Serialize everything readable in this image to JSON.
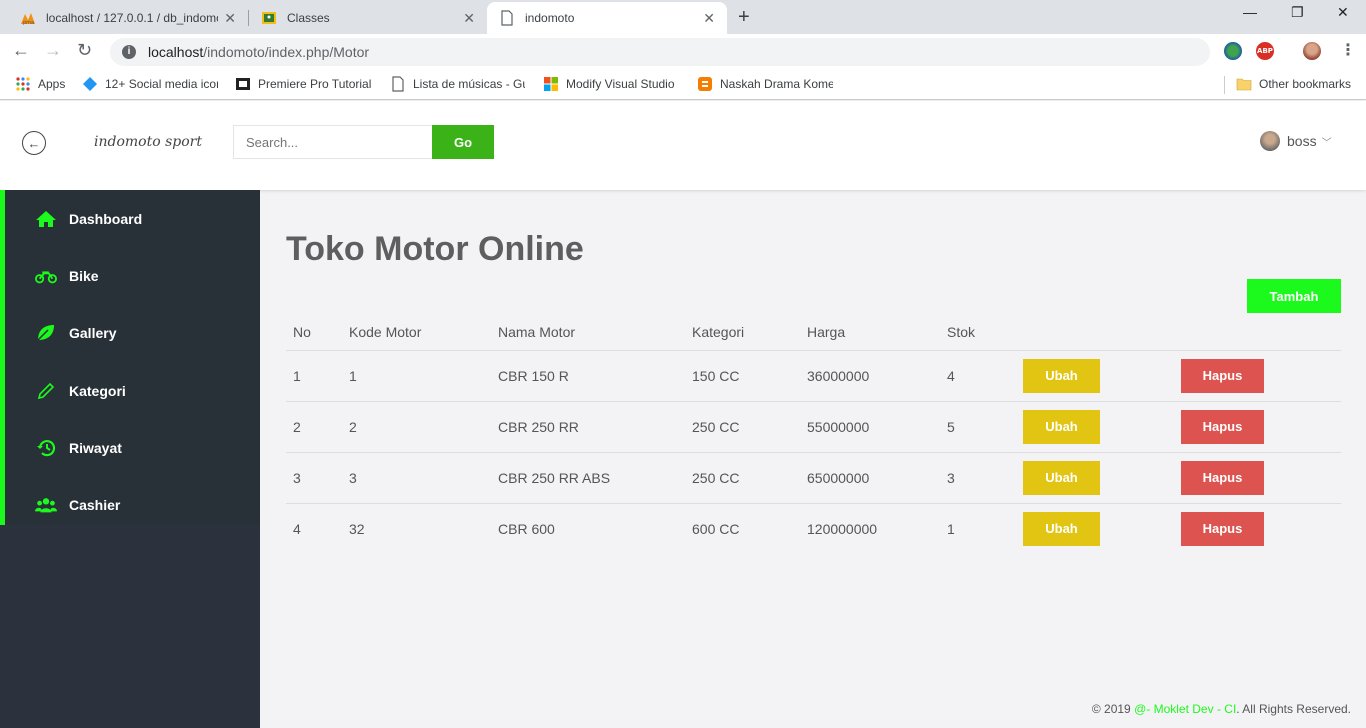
{
  "browser": {
    "tabs": [
      {
        "title": "localhost / 127.0.0.1 / db_indomoto",
        "icon": "phpmyadmin-icon"
      },
      {
        "title": "Classes",
        "icon": "classroom-icon"
      },
      {
        "title": "indomoto",
        "icon": "page-icon"
      }
    ],
    "url_host": "localhost",
    "url_path": "/indomoto/index.php/Motor",
    "bookmarks": [
      {
        "label": "Apps"
      },
      {
        "label": "12+ Social media icon"
      },
      {
        "label": "Premiere Pro Tutorial"
      },
      {
        "label": "Lista de músicas - Gu"
      },
      {
        "label": "Modify Visual Studio"
      },
      {
        "label": "Naskah Drama Kome"
      }
    ],
    "other_bookmarks": "Other bookmarks"
  },
  "header": {
    "brand": "indomoto sport",
    "search_placeholder": "Search...",
    "go_label": "Go",
    "username": "boss"
  },
  "sidebar": {
    "accent": "#1cf91c",
    "items": [
      {
        "label": "Dashboard",
        "icon": "home-icon"
      },
      {
        "label": "Bike",
        "icon": "motorcycle-icon"
      },
      {
        "label": "Gallery",
        "icon": "leaf-icon"
      },
      {
        "label": "Kategori",
        "icon": "pencil-icon"
      },
      {
        "label": "Riwayat",
        "icon": "history-icon"
      },
      {
        "label": "Cashier",
        "icon": "users-icon"
      }
    ]
  },
  "main": {
    "title": "Toko Motor Online",
    "add_label": "Tambah",
    "columns": [
      "No",
      "Kode Motor",
      "Nama Motor",
      "Kategori",
      "Harga",
      "Stok"
    ],
    "rows": [
      {
        "no": "1",
        "kode": "1",
        "nama": "CBR 150 R",
        "kategori": "150 CC",
        "harga": "36000000",
        "stok": "4"
      },
      {
        "no": "2",
        "kode": "2",
        "nama": "CBR 250 RR",
        "kategori": "250 CC",
        "harga": "55000000",
        "stok": "5"
      },
      {
        "no": "3",
        "kode": "3",
        "nama": "CBR 250 RR ABS",
        "kategori": "250 CC",
        "harga": "65000000",
        "stok": "3"
      },
      {
        "no": "4",
        "kode": "32",
        "nama": "CBR 600",
        "kategori": "600 CC",
        "harga": "120000000",
        "stok": "1"
      }
    ],
    "edit_label": "Ubah",
    "delete_label": "Hapus"
  },
  "footer": {
    "prefix": "© 2019 ",
    "link": "@- Moklet Dev - CI",
    "suffix": ". All Rights Reserved."
  }
}
